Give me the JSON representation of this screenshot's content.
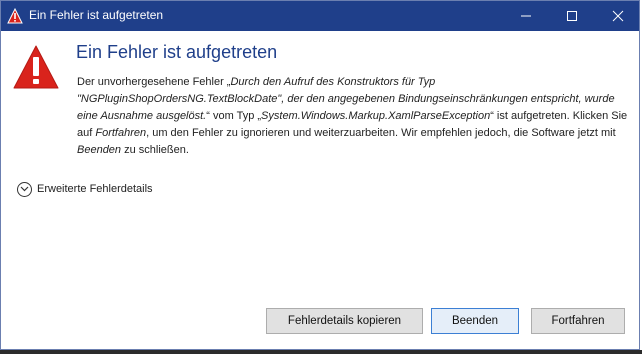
{
  "window": {
    "title": "Ein Fehler ist aufgetreten"
  },
  "content": {
    "heading": "Ein Fehler ist aufgetreten",
    "message": {
      "part1": "Der unvorhergesehene Fehler „",
      "ctor": "Durch den Aufruf des Konstruktors für Typ \"NGPluginShopOrdersNG.TextBlockDate\", der den angegebenen Bindungseinschränkungen entspricht, wurde eine Ausnahme ausgelöst.",
      "part2": "“ vom Typ „",
      "exception": "System.Windows.Markup.XamlParseException",
      "part3": "“ ist aufgetreten. Klicken Sie auf ",
      "continue_word": "Fortfahren",
      "part4": ", um den Fehler zu ignorieren und weiterzuarbeiten. Wir empfehlen jedoch, die Software jetzt mit ",
      "end_word": "Beenden",
      "part5": " zu schließen."
    },
    "details_label": "Erweiterte Fehlerdetails"
  },
  "buttons": {
    "copy": "Fehlerdetails kopieren",
    "end": "Beenden",
    "continue": "Fortfahren"
  },
  "colors": {
    "titlebar": "#1f3f8a",
    "heading": "#1f3f8a",
    "error_red": "#d9231c"
  }
}
